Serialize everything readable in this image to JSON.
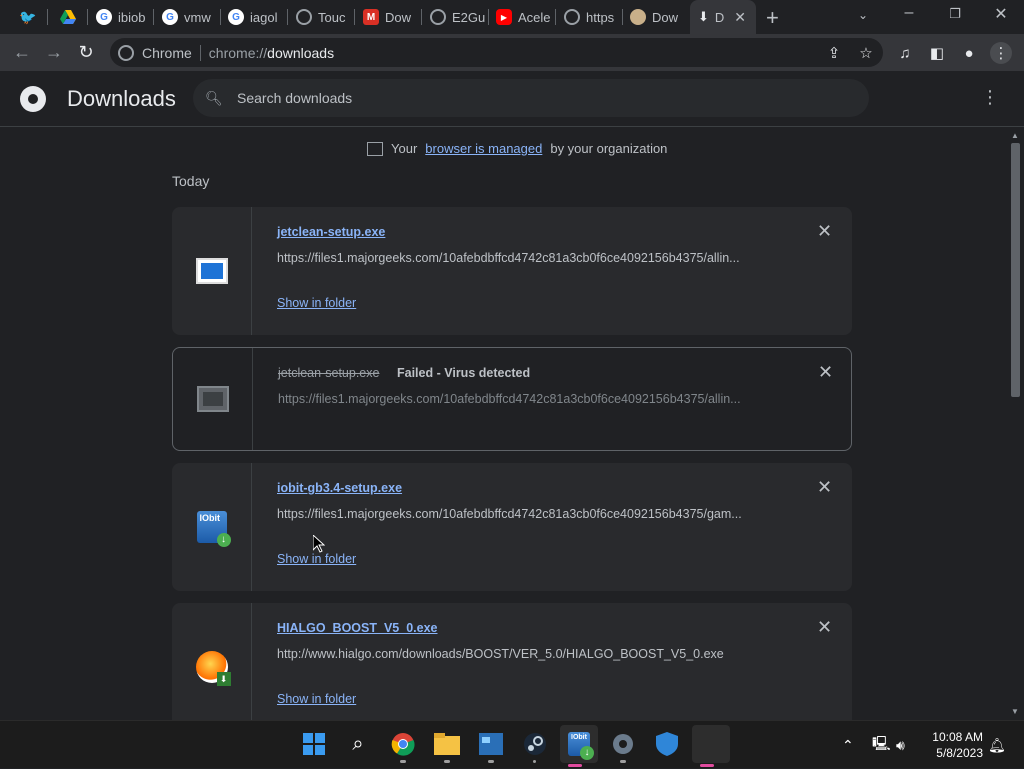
{
  "tabs": [
    {
      "label": "",
      "icon": "twitter-icon",
      "color": "#1d9bf0"
    },
    {
      "label": "",
      "icon": "google-drive-icon",
      "color": "#fbbc04"
    },
    {
      "label": "ibiob",
      "icon": "google-icon",
      "color": "#ffffff"
    },
    {
      "label": "vmw",
      "icon": "google-icon",
      "color": "#ffffff"
    },
    {
      "label": "iagol",
      "icon": "google-icon",
      "color": "#ffffff"
    },
    {
      "label": "Touc",
      "icon": "globe-icon",
      "color": "#9aa0a6"
    },
    {
      "label": "Dow",
      "icon": "malwarebytes-icon",
      "color": "#d93025"
    },
    {
      "label": "E2Gu",
      "icon": "globe-icon",
      "color": "#9aa0a6"
    },
    {
      "label": "Acele",
      "icon": "youtube-icon",
      "color": "#ff0000"
    },
    {
      "label": "https",
      "icon": "globe-icon",
      "color": "#9aa0a6"
    },
    {
      "label": "Dow",
      "icon": "sloth-icon",
      "color": "#c9b08a"
    },
    {
      "label": "D",
      "icon": "download-icon",
      "color": "#e8eaed",
      "active": true
    }
  ],
  "toolbar": {
    "omnibox_label": "Chrome",
    "url_scheme": "chrome://",
    "url_host": "downloads"
  },
  "header": {
    "title": "Downloads",
    "search_placeholder": "Search downloads"
  },
  "managed": {
    "prefix": "Your",
    "link": "browser is managed",
    "suffix": "by your organization"
  },
  "section_label": "Today",
  "downloads": [
    {
      "filename": "jetclean-setup.exe",
      "status": "",
      "url": "https://files1.majorgeeks.com/10afebdbffcd4742c81a3cb0f6ce4092156b4375/allin...",
      "action": "Show in folder",
      "failed": false,
      "icon": "exe-file-icon"
    },
    {
      "filename": "jetclean-setup.exe",
      "status": "Failed - Virus detected",
      "url": "https://files1.majorgeeks.com/10afebdbffcd4742c81a3cb0f6ce4092156b4375/allin...",
      "action": "",
      "failed": true,
      "icon": "exe-file-icon"
    },
    {
      "filename": "iobit-gb3.4-setup.exe",
      "status": "",
      "url": "https://files1.majorgeeks.com/10afebdbffcd4742c81a3cb0f6ce4092156b4375/gam...",
      "action": "Show in folder",
      "failed": false,
      "icon": "iobit-installer-icon"
    },
    {
      "filename": "HIALGO_BOOST_V5_0.exe",
      "status": "",
      "url": "http://www.hialgo.com/downloads/BOOST/VER_5.0/HIALGO_BOOST_V5_0.exe",
      "action": "Show in folder",
      "failed": false,
      "icon": "hialgo-installer-icon"
    }
  ],
  "taskbar": {
    "apps": [
      "windows-start-icon",
      "search-icon",
      "chrome-icon",
      "file-explorer-icon",
      "control-panel-icon",
      "steam-icon",
      "iobit-icon",
      "settings-icon",
      "windows-security-icon",
      "blank-app-icon"
    ],
    "time": "10:08 AM",
    "date": "5/8/2023"
  }
}
